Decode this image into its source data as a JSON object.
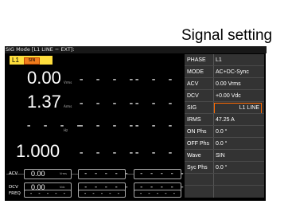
{
  "annotation": {
    "text": "Signal setting",
    "color": "#f07b1c"
  },
  "screen": {
    "title": "SIG Mode [L1 LINE − EXT]:"
  },
  "left": {
    "phase_tab": "L1",
    "phase_badge": "SIN",
    "rows": [
      {
        "value": "0.00",
        "unit": "Vrms",
        "dashes": [
          "- - - -",
          "- - - -"
        ]
      },
      {
        "value": "1.37",
        "unit": "Arms",
        "dashes": [
          "- - - -",
          "- - - -"
        ]
      },
      {
        "value": "- - - -",
        "unit": "Hz",
        "dashes": [
          "- - - -",
          "- - - -"
        ]
      },
      {
        "value": "1.000",
        "unit": "",
        "dashes": [
          "- - - -",
          "- - - -"
        ]
      }
    ],
    "bottom": [
      {
        "label": "ACV",
        "value": "0.00",
        "unit": "Vrms",
        "fields": [
          "- - - - -",
          "- - - - -"
        ]
      },
      {
        "label": "DCV",
        "value": "0.00",
        "unit": "Vdc",
        "fields": [
          "- - - - -",
          "- - - - -"
        ]
      },
      {
        "label": "FREQ",
        "value": "- - - - -",
        "unit": "",
        "fields": [
          "- - - - -",
          "- - - - -"
        ]
      }
    ]
  },
  "settings": [
    {
      "key": "PHASE",
      "value": "L1"
    },
    {
      "key": "MODE",
      "value": "AC+DC-Sync"
    },
    {
      "key": "ACV",
      "value": "0.00 Vrms"
    },
    {
      "key": "DCV",
      "value": "+0.00 Vdc"
    },
    {
      "key": "SIG",
      "value": "L1 LINE"
    },
    {
      "key": "IRMS",
      "value": "47.25 A"
    },
    {
      "key": "ON Phs",
      "value": "0.0 °"
    },
    {
      "key": "OFF Phs",
      "value": "0.0 °"
    },
    {
      "key": "Wave",
      "value": "SIN"
    },
    {
      "key": "Syc Phs",
      "value": "0.0 °"
    },
    {
      "key": "",
      "value": ""
    },
    {
      "key": "",
      "value": ""
    }
  ]
}
